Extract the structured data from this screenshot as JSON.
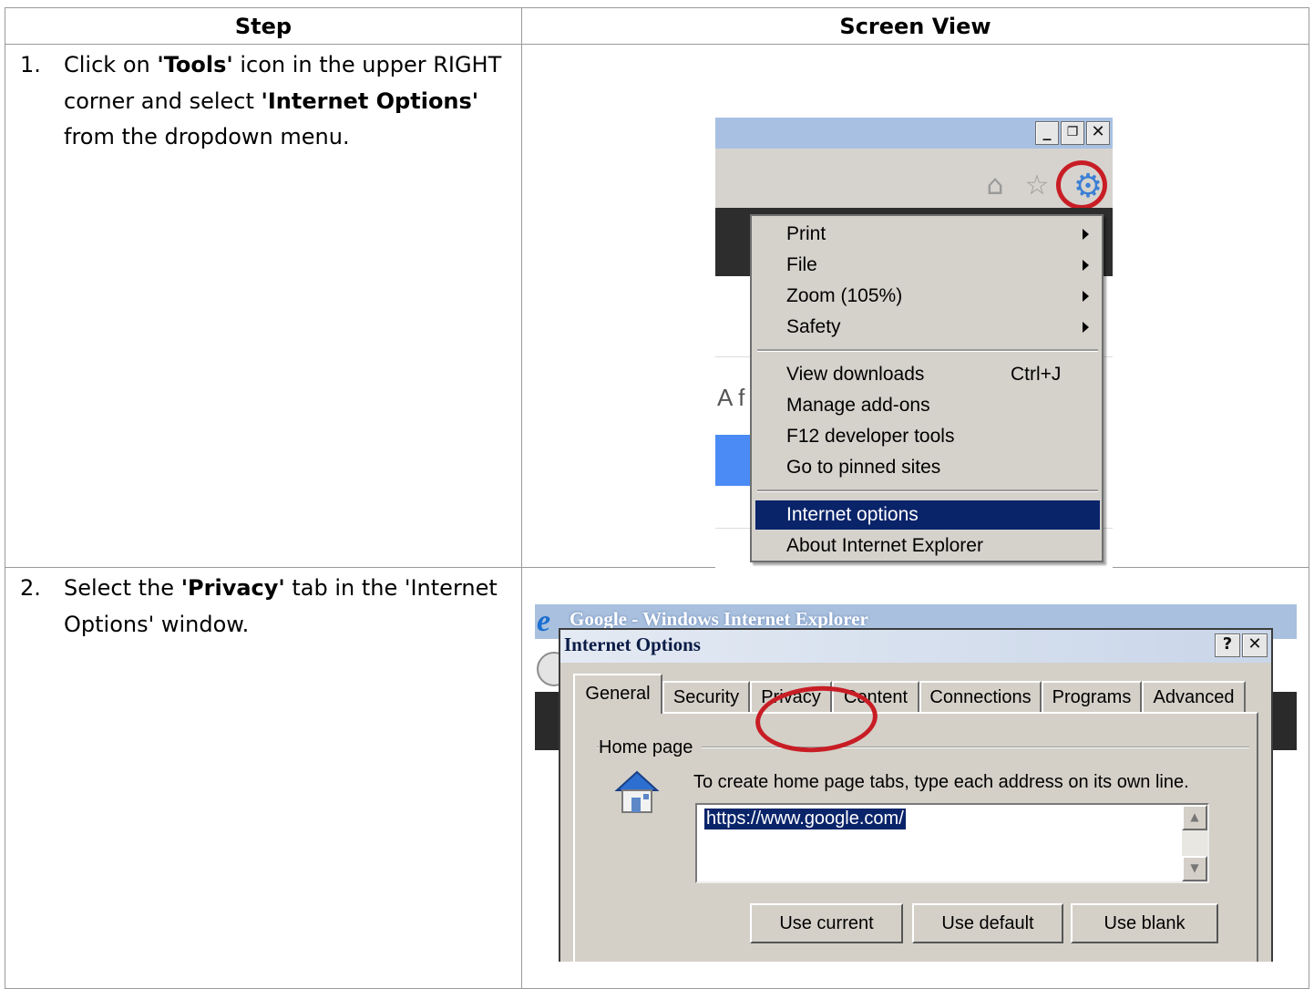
{
  "table": {
    "header_step": "Step",
    "header_view": "Screen View"
  },
  "steps": [
    {
      "number": "1.",
      "parts": [
        "Click on ",
        "'Tools'",
        " icon in the upper RIGHT corner and select ",
        "'Internet Options'",
        " from the dropdown menu."
      ]
    },
    {
      "number": "2.",
      "parts": [
        "Select the ",
        "'Privacy'",
        " tab in the 'Internet Options' window."
      ]
    }
  ],
  "screenshot1": {
    "window_buttons": [
      "_",
      "❐",
      "✕"
    ],
    "page_text": "A f",
    "menu": [
      {
        "label": "Print",
        "submenu": true
      },
      {
        "label": "File",
        "submenu": true
      },
      {
        "label": "Zoom (105%)",
        "submenu": true
      },
      {
        "label": "Safety",
        "submenu": true
      },
      {
        "label": "View downloads",
        "shortcut": "Ctrl+J"
      },
      {
        "label": "Manage add-ons"
      },
      {
        "label": "F12 developer tools"
      },
      {
        "label": "Go to pinned sites"
      },
      {
        "label": "Internet options",
        "selected": true
      },
      {
        "label": "About Internet Explorer"
      }
    ]
  },
  "screenshot2": {
    "ie_window_title": "Google - Windows Internet Explorer",
    "dialog_title": "Internet Options",
    "dialog_buttons": [
      "?",
      "✕"
    ],
    "tabs": [
      "General",
      "Security",
      "Privacy",
      "Content",
      "Connections",
      "Programs",
      "Advanced"
    ],
    "active_tab": "General",
    "group_label": "Home page",
    "group_description": "To create home page tabs, type each address on its own line.",
    "home_url": "https://www.google.com/",
    "buttons": [
      "Use current",
      "Use default",
      "Use blank"
    ]
  }
}
